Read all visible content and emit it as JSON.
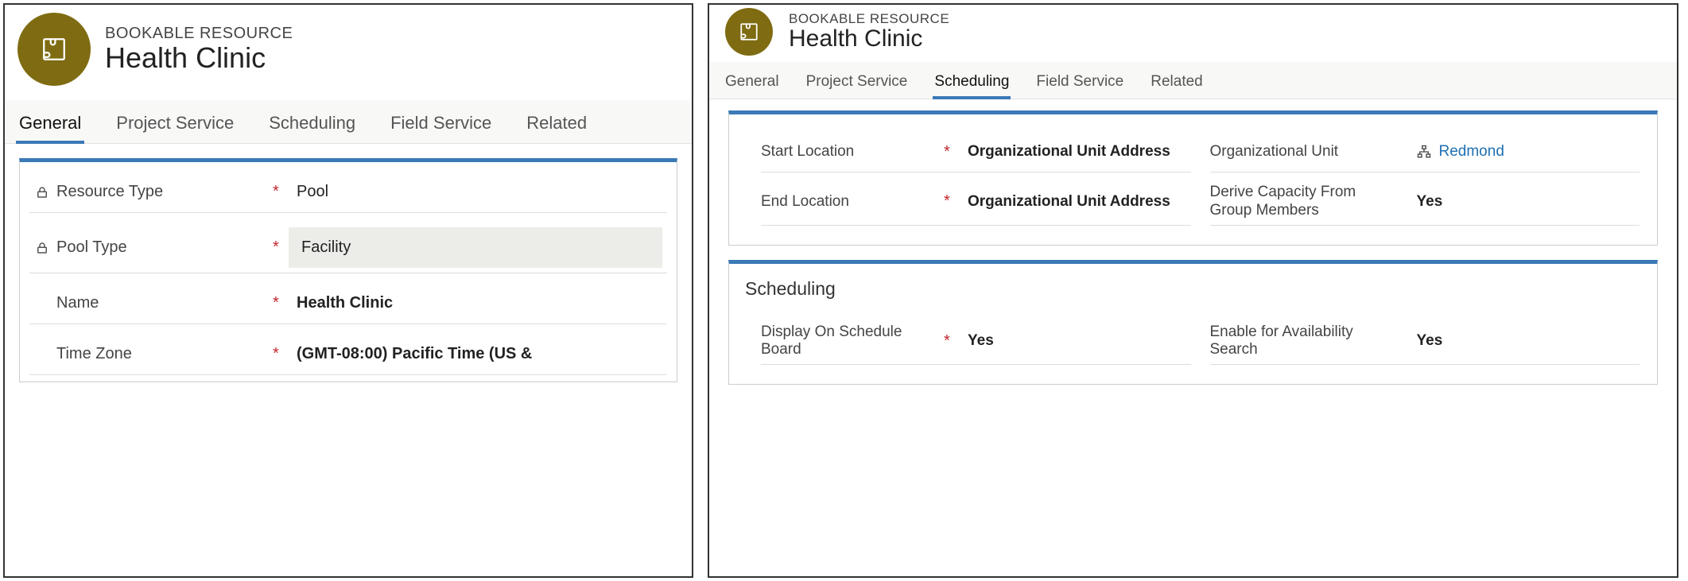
{
  "left": {
    "eyebrow": "BOOKABLE RESOURCE",
    "title": "Health Clinic",
    "tabs": [
      "General",
      "Project Service",
      "Scheduling",
      "Field Service",
      "Related"
    ],
    "active_tab": 0,
    "fields": {
      "resource_type": {
        "label": "Resource Type",
        "value": "Pool"
      },
      "pool_type": {
        "label": "Pool Type",
        "value": "Facility"
      },
      "name": {
        "label": "Name",
        "value": "Health Clinic"
      },
      "time_zone": {
        "label": "Time Zone",
        "value": "(GMT-08:00) Pacific Time (US &"
      }
    }
  },
  "right": {
    "eyebrow": "BOOKABLE RESOURCE",
    "title": "Health Clinic",
    "tabs": [
      "General",
      "Project Service",
      "Scheduling",
      "Field Service",
      "Related"
    ],
    "active_tab": 2,
    "section1": {
      "start_location": {
        "label": "Start Location",
        "value": "Organizational Unit Address"
      },
      "end_location": {
        "label": "End Location",
        "value": "Organizational Unit Address"
      },
      "org_unit": {
        "label": "Organizational Unit",
        "value": "Redmond"
      },
      "derive_capacity": {
        "label": "Derive Capacity From Group Members",
        "value": "Yes"
      }
    },
    "section2": {
      "title": "Scheduling",
      "display_on_board": {
        "label": "Display On Schedule Board",
        "value": "Yes"
      },
      "enable_availability": {
        "label": "Enable for Availability Search",
        "value": "Yes"
      }
    }
  }
}
